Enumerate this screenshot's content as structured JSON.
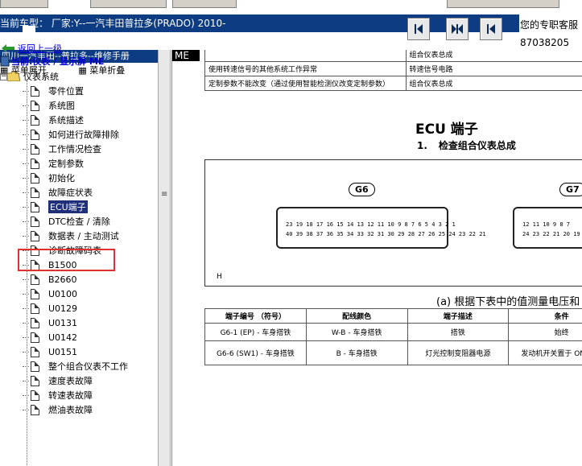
{
  "header": {
    "vehicle_text": "当前车型：  厂家:Y--一汽丰田普拉多(PRADO) 2010-",
    "service_text": "您的专职客服",
    "service_phone": "87038205"
  },
  "nav_buttons": [
    {
      "name": "first-page-button",
      "icon": "arrow-left-bar-icon"
    },
    {
      "name": "split-view-button",
      "icon": "double-arrow-icon"
    },
    {
      "name": "back-page-button",
      "icon": "arrow-left-icon"
    }
  ],
  "left_panel": {
    "manual_title": "四川一汽丰田--普拉多--维修手册",
    "menu_expand": "菜单展开",
    "menu_collapse": "菜单折叠",
    "back_link": "返回上一级",
    "current": "当前:仪表 / 显示屏 ME",
    "folder": "仪表系统",
    "items": [
      "零件位置",
      "系统图",
      "系统描述",
      "如何进行故障排除",
      "工作情况检查",
      "定制参数",
      "初始化",
      "故障症状表",
      "ECU端子",
      "DTC检查 / 清除",
      "数据表 / 主动测试",
      "诊断故障码表",
      "B1500",
      "B2660",
      "U0100",
      "U0129",
      "U0131",
      "U0142",
      "U0151",
      "整个组合仪表不工作",
      "速度表故障",
      "转速表故障",
      "燃油表故障"
    ],
    "selected_index": 8
  },
  "document": {
    "tab_label": "ME",
    "top_table": [
      [
        "",
        "组合仪表总成"
      ],
      [
        "使用转速信号的其他系统工作异常",
        "转速信号电路"
      ],
      [
        "定制参数不能改变（通过使用智能检测仪改变定制参数）",
        "组合仪表总成"
      ]
    ],
    "ecu_title": "ECU 端子",
    "step_num": "1.",
    "step_text": "检查组合仪表总成",
    "connector_g6": "G6",
    "connector_g7": "G7",
    "g6_row1": "23 19 18 17 16 15 14 13 12 11 10 9 8 7 6 5 4 3 2 1",
    "g6_row2": "40 39 38 37 36 35 34 33 32 31 30 29 28 27 26 25 24 23 22 21",
    "g7_row1": "12 11 10 9 8 7",
    "g7_row2": "24 23 22 21 20 19 18",
    "diagram_h": "H",
    "measure_text": "(a)  根据下表中的值测量电压和",
    "table_headers": [
      "端子编号 （符号）",
      "配线颜色",
      "端子描述",
      "条件"
    ],
    "table_rows": [
      [
        "G6-1 (EP) - 车身搭铁",
        "W-B - 车身搭铁",
        "搭铁",
        "始终"
      ],
      [
        "G6-6 (SW1) - 车身搭铁",
        "B - 车身搭铁",
        "灯光控制变阻器电源",
        "发动机开关置于 ON 位置"
      ]
    ]
  }
}
